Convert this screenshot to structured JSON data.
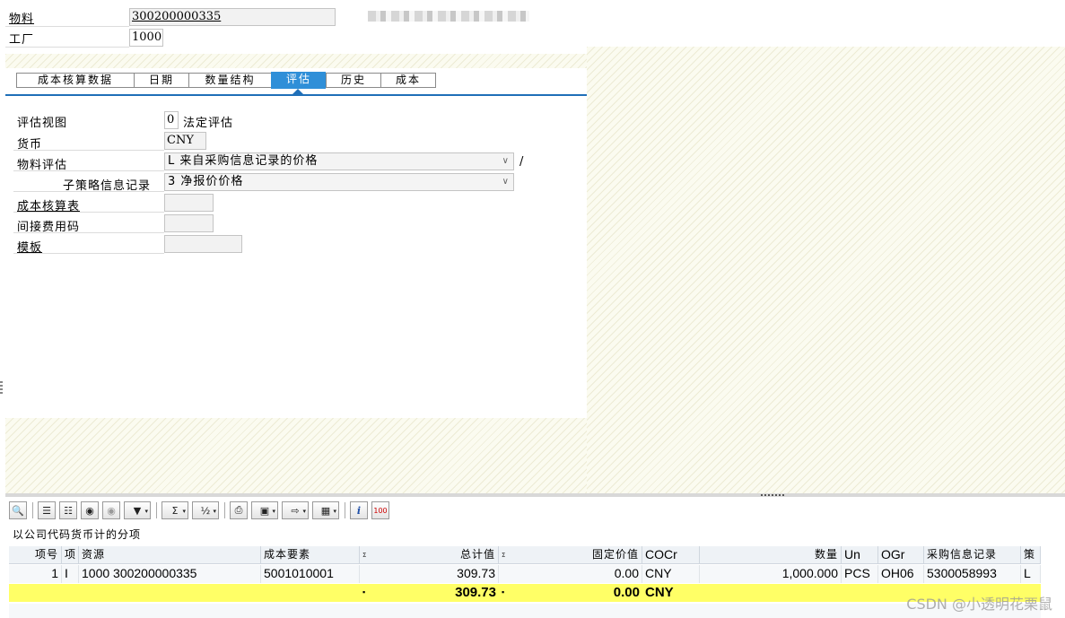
{
  "header": {
    "material_label": "物料",
    "material_value": "300200000335",
    "plant_label": "工厂",
    "plant_value": "1000"
  },
  "tabs": [
    {
      "label": "成本核算数据",
      "active": false
    },
    {
      "label": "日期",
      "active": false
    },
    {
      "label": "数量结构",
      "active": false
    },
    {
      "label": "评估",
      "active": true
    },
    {
      "label": "历史",
      "active": false
    },
    {
      "label": "成本",
      "active": false
    }
  ],
  "form": {
    "valuation_view_label": "评估视图",
    "valuation_view_code": "0",
    "valuation_view_text": "法定评估",
    "currency_label": "货币",
    "currency_value": "CNY",
    "material_valuation_label": "物料评估",
    "material_valuation_value": "L 来自采购信息记录的价格",
    "material_valuation_suffix": "/",
    "substrategy_label": "子策略信息记录",
    "substrategy_value": "3 净报价价格",
    "costing_sheet_label": "成本核算表",
    "costing_sheet_value": "",
    "overhead_key_label": "间接费用码",
    "overhead_key_value": "",
    "template_label": "模板",
    "template_value": ""
  },
  "grid": {
    "title": "以公司代码货币计的分项",
    "sigma": "Σ",
    "total_dot": "▪",
    "columns": [
      "项号",
      "项",
      "资源",
      "成本要素",
      "总计值",
      "固定价值",
      "COCr",
      "数量",
      "Un",
      "OGr",
      "采购信息记录",
      "策"
    ],
    "rows": [
      {
        "item": "1",
        "type": "I",
        "resource": "1000 300200000335",
        "cost_element": "5001010001",
        "total": "309.73",
        "fixed": "0.00",
        "currency": "CNY",
        "quantity": "1,000.000",
        "unit": "PCS",
        "ogr": "OH06",
        "info_record": "5300058993",
        "strategy": "L"
      }
    ],
    "totals": {
      "total": "309.73",
      "fixed": "0.00",
      "currency": "CNY"
    }
  },
  "toolbar": {
    "icons": [
      "details-icon",
      "sort-ascending-icon",
      "sort-descending-icon",
      "find-icon",
      "find-next-icon",
      "filter-icon",
      "sum-icon",
      "subtotal-icon",
      "print-icon",
      "views-icon",
      "export-icon",
      "layout-icon",
      "info-icon",
      "abc-analysis-icon"
    ]
  },
  "watermark": "CSDN @小透明花栗鼠"
}
